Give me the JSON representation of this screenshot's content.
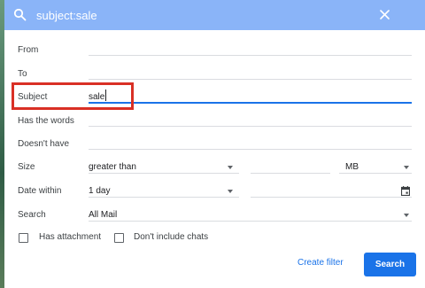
{
  "search": {
    "query": "subject:sale"
  },
  "form": {
    "from": {
      "label": "From",
      "value": ""
    },
    "to": {
      "label": "To",
      "value": ""
    },
    "subject": {
      "label": "Subject",
      "value": "sale"
    },
    "has_words": {
      "label": "Has the words",
      "value": ""
    },
    "doesnt_have": {
      "label": "Doesn't have",
      "value": ""
    },
    "size": {
      "label": "Size",
      "operator": "greater than",
      "value": "",
      "unit": "MB"
    },
    "date_within": {
      "label": "Date within",
      "value": "1 day",
      "date": ""
    },
    "search_in": {
      "label": "Search",
      "value": "All Mail"
    }
  },
  "options": {
    "has_attachment": "Has attachment",
    "dont_include_chats": "Don't include chats"
  },
  "actions": {
    "create_filter": "Create filter",
    "search": "Search"
  },
  "colors": {
    "search_bar": "#8ab4f8",
    "accent": "#1a73e8",
    "highlight": "#d93025"
  }
}
